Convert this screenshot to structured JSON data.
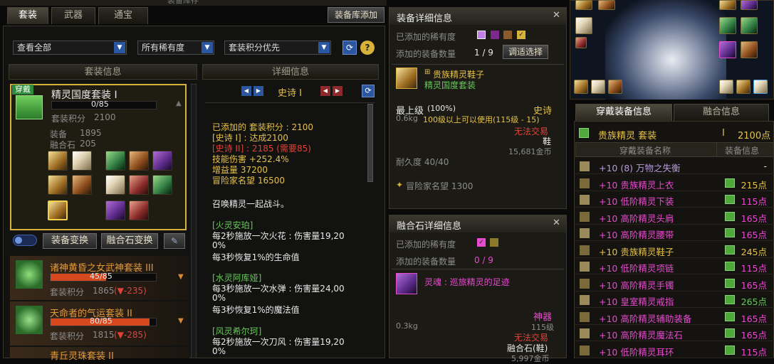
{
  "window": {
    "title_fragment": "装备库存",
    "library_add_button": "装备库添加"
  },
  "left_tabs": [
    "套装",
    "武器",
    "通宝"
  ],
  "filters": {
    "view": "查看全部",
    "rarity": "所有稀有度",
    "sort": "套装积分优先",
    "help": "?"
  },
  "set_info_header": "套装信息",
  "detail_header": "详细信息",
  "wearing_badge": "穿戴",
  "current_set": {
    "name": "精灵国度套装 I",
    "progress_text": "0/85",
    "progress": 0.0,
    "score_label": "套装积分",
    "score": "2100",
    "equip_label": "装备",
    "equip_value": "1895",
    "fusion_label": "融合石",
    "fusion_value": "205"
  },
  "switch_buttons": {
    "equip_swap": "装备变换",
    "fusion_swap": "融合石变换"
  },
  "other_sets": [
    {
      "name": "诸神黄昏之女武神套装 III",
      "progress_text": "45/85",
      "progress": 0.53,
      "score_label": "套装积分",
      "score": "1865",
      "delta": "(▼-235)"
    },
    {
      "name": "天命者的气运套装 II",
      "progress_text": "80/85",
      "progress": 0.94,
      "score_label": "套装积分",
      "score": "1815",
      "delta": "(▼-285)"
    },
    {
      "name": "青丘灵珠套装 II"
    }
  ],
  "detail": {
    "nav_title": "史诗 I",
    "lines": [
      {
        "text": "已添加的 套装积分 : 2100",
        "color": "#e6c24a"
      },
      {
        "text": "[史诗 I] : 达成2100",
        "color": "#e6c24a"
      },
      {
        "text": "[史诗 II] : 2185 (需要85)",
        "color": "#e0433a"
      },
      {
        "text": "技能伤害 +252.4%",
        "color": "#e6c24a"
      },
      {
        "text": "增益量 37200",
        "color": "#e6c24a"
      },
      {
        "text": "冒险家名望 16500",
        "color": "#e6c24a"
      }
    ],
    "summon": "召唤精灵一起战斗。",
    "blocks": [
      {
        "title": "[火灵安珀]",
        "l1": "每2秒施放一次火花 : 伤害量19,20",
        "l2": "0%",
        "l3": "每3秒恢复1%的生命值"
      },
      {
        "title": "[水灵阿库娅]",
        "l1": "每3秒施放一次水弹 : 伤害量24,00",
        "l2": "0%",
        "l3": "每3秒恢复1%的魔法值"
      },
      {
        "title": "[风灵希尔珂]",
        "l1": "每2秒施放一次刀风 : 伤害量19,20",
        "l2": "0%",
        "l3": ""
      }
    ]
  },
  "equip_detail": {
    "header": "装备详细信息",
    "rarity_label": "已添加的稀有度",
    "count_label": "添加的装备数量",
    "count": "1 / 9",
    "adjust_button": "调适选择",
    "item_name": "贵族精灵鞋子",
    "item_set": "精灵国度套装",
    "grade": "最上级",
    "grade_pct": "(100%)",
    "rarity": "史诗",
    "weight": "0.6kg",
    "level_req": "100级以上可以使用(115级 - 15)",
    "trade": "无法交易",
    "slot": "鞋",
    "price": "15,681金币",
    "durability": "耐久度 40/40",
    "fame": "冒险家名望 1300"
  },
  "fusion_detail": {
    "header": "融合石详细信息",
    "rarity_label": "已添加的稀有度",
    "count_label": "添加的装备数量",
    "count": "0 / 9",
    "item_name": "灵魂 : 巡旅精灵的足迹",
    "rarity": "神器",
    "weight": "0.3kg",
    "level": "115级",
    "trade": "无法交易",
    "slot": "融合石(鞋)",
    "price": "5,997金币"
  },
  "right_tabs": [
    "穿戴装备信息",
    "融合信息"
  ],
  "set_summary": {
    "name": "贵族精灵 套装",
    "tier": "I",
    "points": "2100点"
  },
  "equip_cols": [
    "穿戴装备名称",
    "装备信息"
  ],
  "equip_list": [
    {
      "name": "+10 (8) 万物之失衡",
      "color": "#b79bdc",
      "points": "-",
      "pcolor": "#e8e8e8",
      "book": false
    },
    {
      "name": "+10 贵族精灵上衣",
      "color": "#e94bd0",
      "points": "215点",
      "pcolor": "#e6c24a",
      "book": true
    },
    {
      "name": "+10 低阶精灵下装",
      "color": "#e94bd0",
      "points": "115点",
      "pcolor": "#e94bd0",
      "book": true
    },
    {
      "name": "+10 高阶精灵头肩",
      "color": "#e94bd0",
      "points": "165点",
      "pcolor": "#e94bd0",
      "book": true
    },
    {
      "name": "+10 高阶精灵腰带",
      "color": "#e94bd0",
      "points": "165点",
      "pcolor": "#e94bd0",
      "book": true
    },
    {
      "name": "+10 贵族精灵鞋子",
      "color": "#e6c24a",
      "points": "245点",
      "pcolor": "#e6c24a",
      "book": true
    },
    {
      "name": "+10 低阶精灵项链",
      "color": "#e94bd0",
      "points": "115点",
      "pcolor": "#e94bd0",
      "book": true
    },
    {
      "name": "+10 高阶精灵手镯",
      "color": "#e94bd0",
      "points": "165点",
      "pcolor": "#e94bd0",
      "book": true
    },
    {
      "name": "+10 皇室精灵戒指",
      "color": "#e94bd0",
      "points": "265点",
      "pcolor": "#69c75b",
      "book": true
    },
    {
      "name": "+10 高阶精灵辅助装备",
      "color": "#e94bd0",
      "points": "165点",
      "pcolor": "#e94bd0",
      "book": true
    },
    {
      "name": "+10 高阶精灵魔法石",
      "color": "#e94bd0",
      "points": "165点",
      "pcolor": "#e94bd0",
      "book": true
    },
    {
      "name": "+10 低阶精灵耳环",
      "color": "#e94bd0",
      "points": "115点",
      "pcolor": "#e94bd0",
      "book": true
    }
  ]
}
